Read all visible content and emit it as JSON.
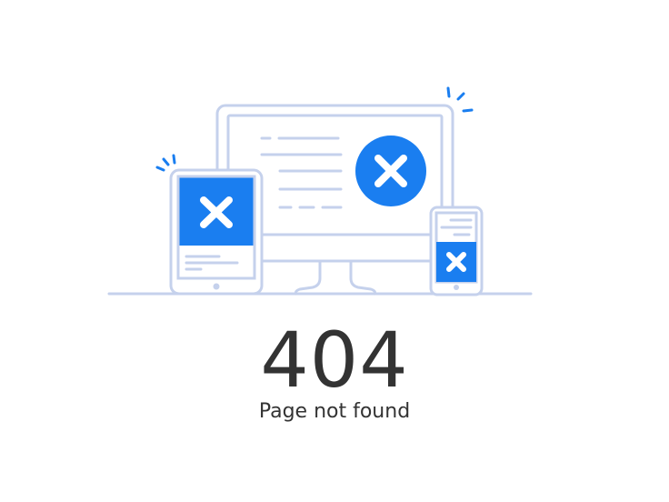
{
  "error": {
    "code": "404",
    "message": "Page not found"
  },
  "illustration": {
    "icons": [
      "monitor-icon",
      "tablet-icon",
      "phone-icon",
      "close-icon"
    ]
  },
  "colors": {
    "outline": "#c5d1ec",
    "accent": "#1a7ef0",
    "text": "#333333",
    "background": "#ffffff"
  }
}
